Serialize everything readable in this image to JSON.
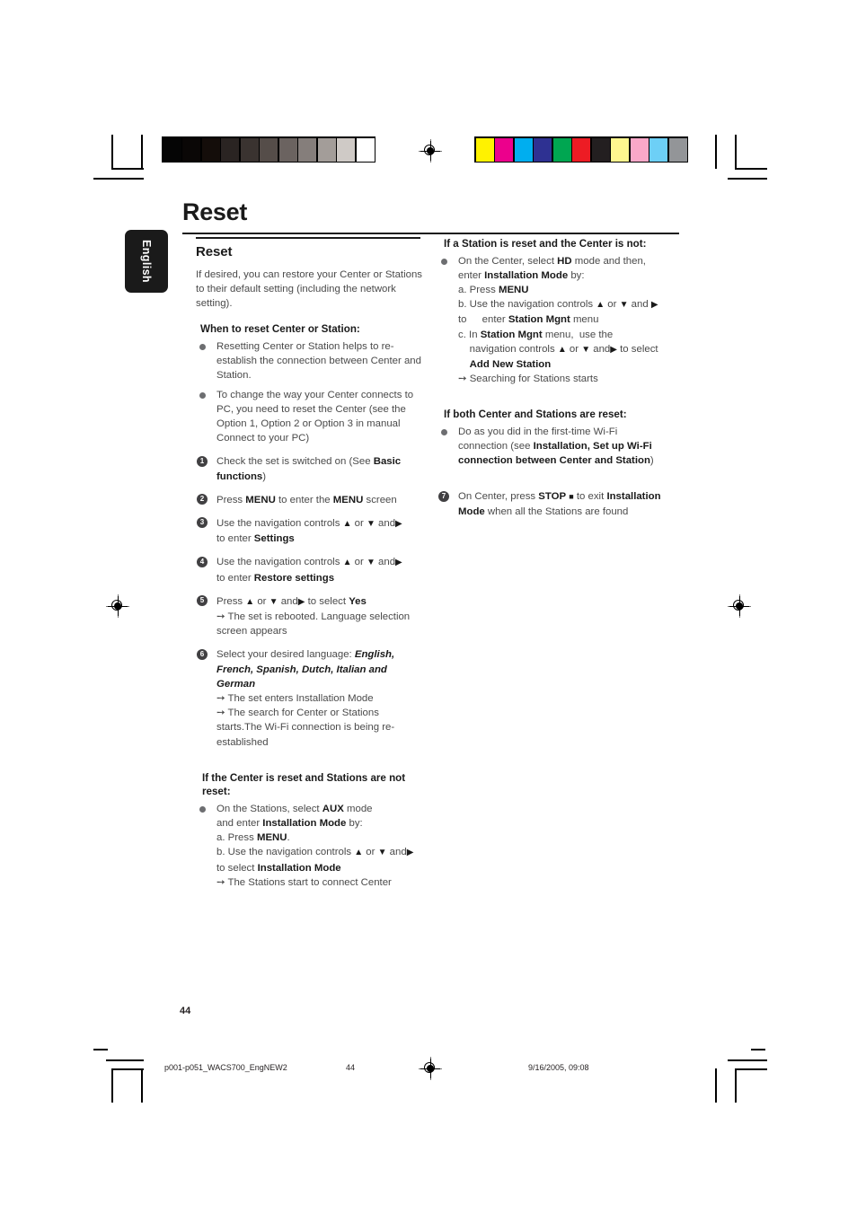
{
  "print_marks": {
    "registration_icon": "registration-target",
    "grayscale_swatches": [
      "#050505",
      "#0a0706",
      "#140d0a",
      "#2a2422",
      "#3a3330",
      "#554d49",
      "#6b6360",
      "#857e7b",
      "#a39d99",
      "#cfcac6",
      "#ffffff"
    ],
    "color_swatches": [
      "#fff200",
      "#ec008c",
      "#00aeef",
      "#2e3192",
      "#00a651",
      "#ed1c24",
      "#231f20",
      "#fff68f",
      "#f9a8c8",
      "#6dcff6",
      "#939598"
    ]
  },
  "language_tab": {
    "label": "English"
  },
  "header": {
    "title": "Reset"
  },
  "left_column": {
    "section_title": "Reset",
    "intro": "If desired, you can restore your Center or Stations to their default setting (including the network setting).",
    "when_to_reset_heading": "When to reset Center or Station:",
    "when_to_reset_bullets": [
      "Resetting Center or Station helps to re-establish the connection between Center and Station.",
      "To change the way your Center connects to PC, you need to reset the Center (see the Option 1, Option 2 or Option 3 in manual Connect to your PC)"
    ],
    "steps": [
      {
        "num": "1",
        "html": "Check the set is switched on (See <b>Basic functions</b>)"
      },
      {
        "num": "2",
        "html": "Press <b>MENU</b> to enter the <b>MENU</b> screen"
      },
      {
        "num": "3",
        "html": "Use the navigation controls <span class=\"tri\">&#9650;</span> or <span class=\"tri\">&#9660;</span> and<span class=\"tri\">&#9654;</span><br>to enter <b>Settings</b>"
      },
      {
        "num": "4",
        "html": "Use the navigation controls <span class=\"tri\">&#9650;</span> or <span class=\"tri\">&#9660;</span> and<span class=\"tri\">&#9654;</span><br>to enter <b>Restore settings</b>"
      },
      {
        "num": "5",
        "html": "Press <span class=\"tri\">&#9650;</span> or <span class=\"tri\">&#9660;</span> and<span class=\"tri\">&#9654;</span> to select <b>Yes</b><br><span class=\"arrow\">&#10137;</span> The set is rebooted. Language selection screen appears"
      },
      {
        "num": "6",
        "html": "Select your desired language: <i class=\"bi\">English, French, Spanish, Dutch, Italian and German</i><br><span class=\"arrow\">&#10137;</span> The set enters Installation Mode<br><span class=\"arrow\">&#10137;</span> The search for Center or Stations starts.The Wi-Fi connection is being re-established"
      }
    ],
    "center_reset_heading": "If the Center is reset and Stations are not reset:",
    "center_reset_bullet": "On the Stations, select <b>AUX</b> mode<br>and enter <b>Installation Mode</b> by:<br>a. Press <b>MENU</b>.<br>b. Use the navigation controls <span class=\"tri\">&#9650;</span> or <span class=\"tri\">&#9660;</span> and<span class=\"tri\">&#9654;</span> to select <b>Installation Mode</b><br><span class=\"arrow\">&#10137;</span> The Stations start to connect Center"
  },
  "right_column": {
    "station_reset_heading": "If a Station is reset and the Center is not:",
    "station_reset_bullet": "On the Center, select <b>HD</b> mode and then, enter <b>Installation Mode</b> by:<br>a. Press <b>MENU</b><br>b. Use the navigation controls <span class=\"tri\">&#9650;</span> or <span class=\"tri\">&#9660;</span> and <span class=\"tri\">&#9654;</span> to <span class=\"sub-line ind2\" style=\"display:inline\">enter <b>Station Mgnt</b> menu</span><br>c. In <b>Station Mgnt</b> menu,&nbsp; use the<br>&nbsp;&nbsp;&nbsp;&nbsp;navigation controls <span class=\"tri\">&#9650;</span> or <span class=\"tri\">&#9660;</span> and<span class=\"tri\">&#9654;</span> to select<br>&nbsp;&nbsp;&nbsp;&nbsp;<b>Add New Station</b><br><span class=\"arrow\">&#10137;</span> Searching for Stations starts",
    "both_reset_heading": "If both Center and Stations are reset:",
    "both_reset_bullet": "Do as you did in the first-time Wi-Fi connection (see <b>Installation, Set up Wi-Fi connection between Center and Station</b>)",
    "final_step": {
      "num": "7",
      "html": "On Center, press <b>STOP</b> <span class=\"sq\">&#9632;</span> to exit <b>Installation Mode</b> when all the Stations are found"
    }
  },
  "footer": {
    "page_number": "44",
    "file_name": "p001-p051_WACS700_EngNEW2",
    "footer_page": "44",
    "timestamp": "9/16/2005, 09:08"
  }
}
